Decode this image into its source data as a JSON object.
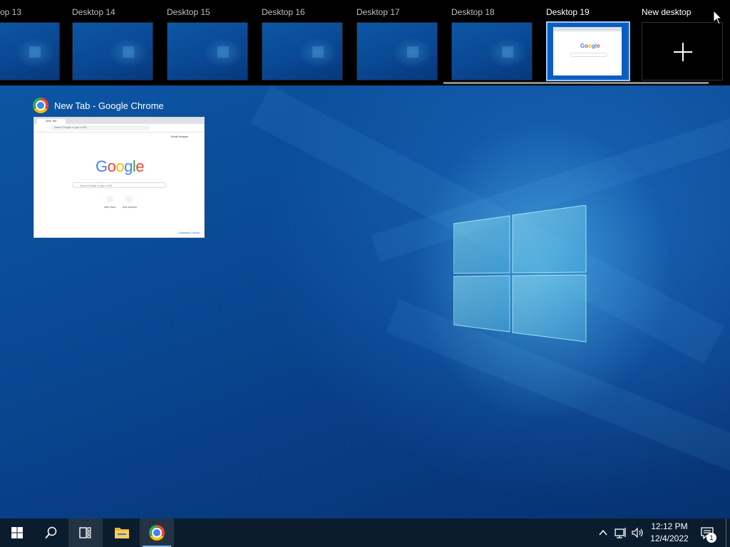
{
  "task_view": {
    "desktops": [
      {
        "label": "op 13"
      },
      {
        "label": "Desktop 14"
      },
      {
        "label": "Desktop 15"
      },
      {
        "label": "Desktop 16"
      },
      {
        "label": "Desktop 17"
      },
      {
        "label": "Desktop 18"
      },
      {
        "label": "Desktop 19",
        "active": true
      }
    ],
    "new_desktop_label": "New desktop"
  },
  "window": {
    "title": "New Tab - Google Chrome",
    "icon": "chrome-icon",
    "preview": {
      "tab_title": "New Tab",
      "omnibox_placeholder": "Search Google or type a URL",
      "top_links": "Gmail   Images",
      "logo_text": "Google",
      "search_placeholder": "Search Google or type a URL",
      "shortcuts": [
        "Web Store",
        "Add shortcut"
      ],
      "customize": "Customize Chrome"
    }
  },
  "taskbar": {
    "items": [
      {
        "name": "start-button",
        "icon": "windows-icon"
      },
      {
        "name": "search-button",
        "icon": "search-icon"
      },
      {
        "name": "task-view-button",
        "icon": "task-view-icon"
      },
      {
        "name": "file-explorer-button",
        "icon": "folder-icon"
      },
      {
        "name": "chrome-taskbar-button",
        "icon": "chrome-icon"
      }
    ],
    "clock_time": "12:12 PM",
    "clock_date": "12/4/2022",
    "notification_count": "1"
  },
  "colors": {
    "taskbar": "#0b1c2e",
    "topbar": "#000000",
    "accent": "#7fb6e6"
  }
}
